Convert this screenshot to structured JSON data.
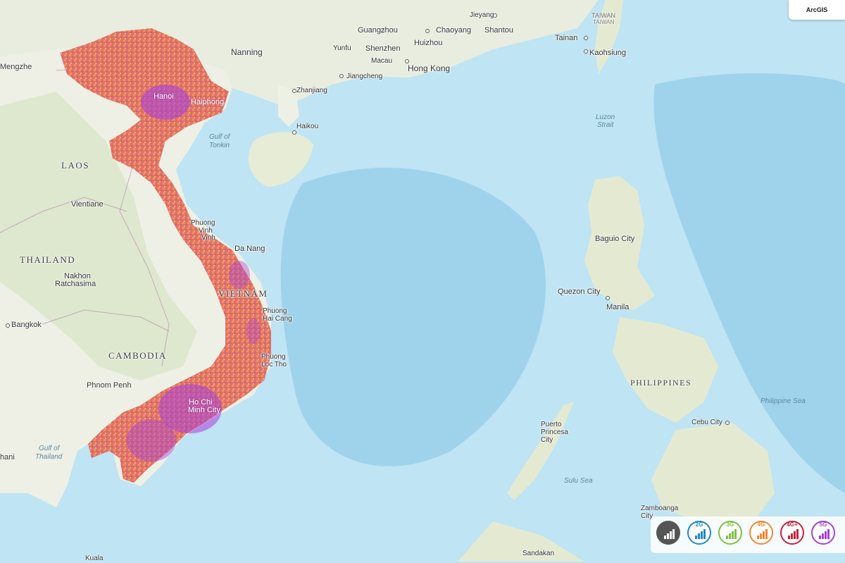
{
  "map": {
    "badge": "ArcGIS",
    "labels": {
      "mengzhe": "Mengzhe",
      "nanning": "Nanning",
      "yunfu": "Yunfu",
      "guangzhou": "Guangzhou",
      "chaoyang": "Chaoyang",
      "shantou": "Shantou",
      "jieyang": "Jieyang",
      "shenzhen": "Shenzhen",
      "huizhou": "Huizhou",
      "macau": "Macau",
      "hongkong": "Hong Kong",
      "jiangcheng": "Jiangcheng",
      "zhanjiang": "Zhanjiang",
      "haikou": "Haikou",
      "tainan": "Tainan",
      "kaohsiung": "Kaohsiung",
      "taiwan1": "TAIWAN",
      "taiwan2": "TAIWAN",
      "hanoi": "Hanoi",
      "haiphong": "Haiphong",
      "gulf_tonkin_1": "Gulf of",
      "gulf_tonkin_2": "Tonkin",
      "laos": "LAOS",
      "vientiane": "Vientiane",
      "thailand": "THAILAND",
      "nakhon_1": "Nakhon",
      "nakhon_2": "Ratchasima",
      "bangkok": "Bangkok",
      "cambodia": "CAMBODIA",
      "phnompenh": "Phnom Penh",
      "phuong_vinh_1": "Phuong",
      "phuong_vinh_2": "Vinh",
      "phuong_vinh_3": "Vinh",
      "danang": "Da Nang",
      "vietnam": "VIETNAM",
      "phuong_hai_1": "Phuong",
      "phuong_hai_2": "Hai Cang",
      "phuong_loc_1": "Phuong",
      "phuong_loc_2": "Loc Tho",
      "hcm_1": "Ho Chi",
      "hcm_2": "Minh City",
      "gulf_thailand_1": "Gulf of",
      "gulf_thailand_2": "Thailand",
      "luzon_1": "Luzon",
      "luzon_2": "Strait",
      "baguio": "Baguio City",
      "quezon": "Quezon City",
      "manila": "Manila",
      "philippines": "PHILIPPINES",
      "philippine_sea": "Philippine Sea",
      "puerto_1": "Puerto",
      "puerto_2": "Princesa",
      "puerto_3": "City",
      "cebu": "Cebu City",
      "sulu": "Sulu Sea",
      "zamboanga_1": "Zamboanga",
      "zamboanga_2": "City",
      "sandakan": "Sandakan",
      "hani": "hani",
      "kuala": "Kuala"
    }
  },
  "legend": {
    "items": [
      {
        "label": "",
        "color": "#555555",
        "icon": "no-coverage-icon"
      },
      {
        "label": "2G",
        "color": "#1f86c8",
        "icon": "signal-2g-icon"
      },
      {
        "label": "3G",
        "color": "#7cc043",
        "icon": "signal-3g-icon"
      },
      {
        "label": "4G",
        "color": "#f58634",
        "icon": "signal-4g-icon"
      },
      {
        "label": "4G+",
        "color": "#c8203a",
        "icon": "signal-4gplus-icon"
      },
      {
        "label": "5G",
        "color": "#a640d8",
        "icon": "signal-5g-icon"
      }
    ]
  }
}
